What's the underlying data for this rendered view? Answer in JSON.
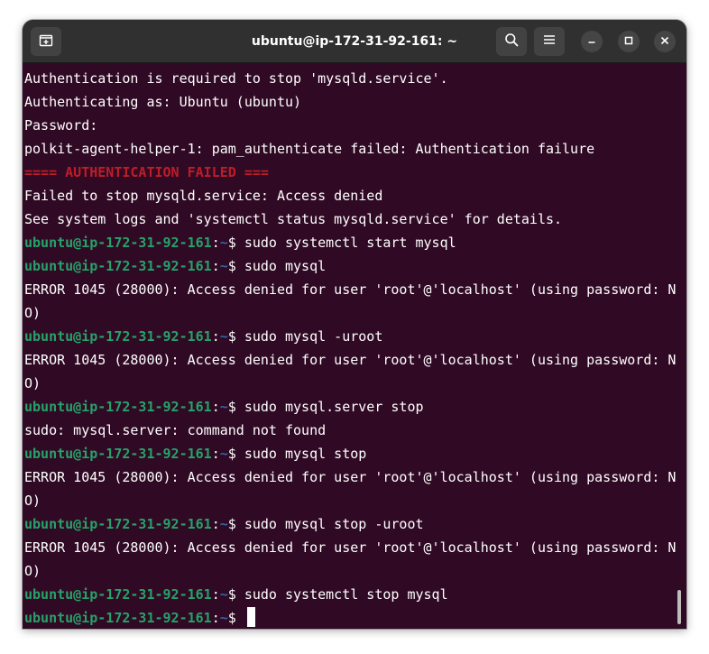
{
  "window": {
    "title": "ubuntu@ip-172-31-92-161: ~"
  },
  "icons": {
    "new_tab": "new-tab-icon",
    "search": "search-icon",
    "menu": "hamburger-menu-icon",
    "minimize": "minimize-icon",
    "maximize": "maximize-icon",
    "close": "close-icon"
  },
  "colors": {
    "terminal_bg": "#300a24",
    "titlebar_bg": "#303030",
    "prompt_user": "#26a269",
    "prompt_path": "#3465a4",
    "error_banner": "#c01c28"
  },
  "terminal": {
    "prompt": {
      "user_host": "ubuntu@ip-172-31-92-161",
      "sep": ":",
      "path": "~",
      "symbol": "$ "
    },
    "lines": [
      {
        "type": "output",
        "text": "Authentication is required to stop 'mysqld.service'."
      },
      {
        "type": "output",
        "text": "Authenticating as: Ubuntu (ubuntu)"
      },
      {
        "type": "output",
        "text": "Password:"
      },
      {
        "type": "output",
        "text": "polkit-agent-helper-1: pam_authenticate failed: Authentication failure"
      },
      {
        "type": "error",
        "text": "==== AUTHENTICATION FAILED ==="
      },
      {
        "type": "output",
        "text": "Failed to stop mysqld.service: Access denied"
      },
      {
        "type": "output",
        "text": "See system logs and 'systemctl status mysqld.service' for details."
      },
      {
        "type": "prompt",
        "text": "sudo systemctl start mysql"
      },
      {
        "type": "prompt",
        "text": "sudo mysql"
      },
      {
        "type": "output",
        "text": "ERROR 1045 (28000): Access denied for user 'root'@'localhost' (using password: N"
      },
      {
        "type": "output",
        "text": "O)"
      },
      {
        "type": "prompt",
        "text": "sudo mysql -uroot"
      },
      {
        "type": "output",
        "text": "ERROR 1045 (28000): Access denied for user 'root'@'localhost' (using password: N"
      },
      {
        "type": "output",
        "text": "O)"
      },
      {
        "type": "prompt",
        "text": "sudo mysql.server stop"
      },
      {
        "type": "output",
        "text": "sudo: mysql.server: command not found"
      },
      {
        "type": "prompt",
        "text": "sudo mysql stop"
      },
      {
        "type": "output",
        "text": "ERROR 1045 (28000): Access denied for user 'root'@'localhost' (using password: N"
      },
      {
        "type": "output",
        "text": "O)"
      },
      {
        "type": "prompt",
        "text": "sudo mysql stop -uroot"
      },
      {
        "type": "output",
        "text": "ERROR 1045 (28000): Access denied for user 'root'@'localhost' (using password: N"
      },
      {
        "type": "output",
        "text": "O)"
      },
      {
        "type": "prompt",
        "text": "sudo systemctl stop mysql"
      },
      {
        "type": "input",
        "text": ""
      }
    ]
  }
}
